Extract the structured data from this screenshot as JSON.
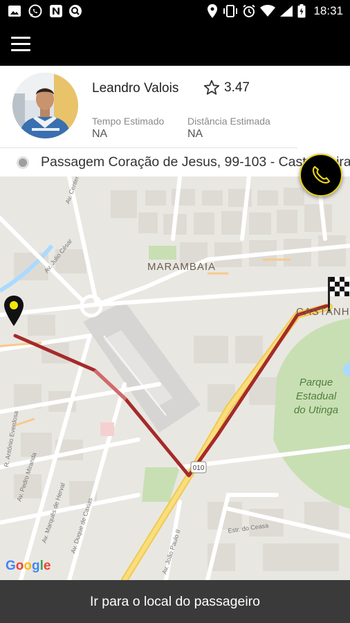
{
  "status_bar": {
    "time": "18:31",
    "left_icons": [
      "gallery-icon",
      "whatsapp-icon",
      "n-app-icon",
      "search-app-icon"
    ],
    "right_icons": [
      "location-icon",
      "vibrate-icon",
      "alarm-icon",
      "wifi-icon",
      "battery-icon"
    ]
  },
  "toolbar": {
    "menu_icon": "hamburger-menu-icon"
  },
  "driver": {
    "name": "Leandro Valois",
    "rating": "3.47",
    "rating_icon": "star-outline-icon",
    "estimated_time_label": "Tempo Estimado",
    "estimated_time_value": "NA",
    "estimated_distance_label": "Distância Estimada",
    "estimated_distance_value": "NA"
  },
  "address": {
    "text": "Passagem Coração de Jesus, 99-103 - Castanheira"
  },
  "call_button": {
    "icon": "phone-icon",
    "accent_color": "#e8d21f"
  },
  "map": {
    "labels": {
      "neighborhood_1": "MARAMBAIA",
      "neighborhood_2": "CASTANH",
      "park": [
        "Parque",
        "Estadual",
        "do Utinga"
      ],
      "road_badge": "010",
      "street_1": "Av. Julio César",
      "street_2": "R. Antônio Everdosa",
      "street_3": "Av. Pedro Miranda",
      "street_4": "Av. Marquês de Herval",
      "street_5": "Av. Duque de Caxias",
      "street_6": "Av. João Paulo II",
      "street_7": "Estr. do Ceasa",
      "street_8": "Av. Centenário",
      "watermark": "Google"
    },
    "route_color": "#a52a2a",
    "origin_pin_color": "#f5e60a",
    "destination_icon": "checkered-flag-icon"
  },
  "bottom_action": {
    "label": "Ir para o local do passageiro"
  }
}
